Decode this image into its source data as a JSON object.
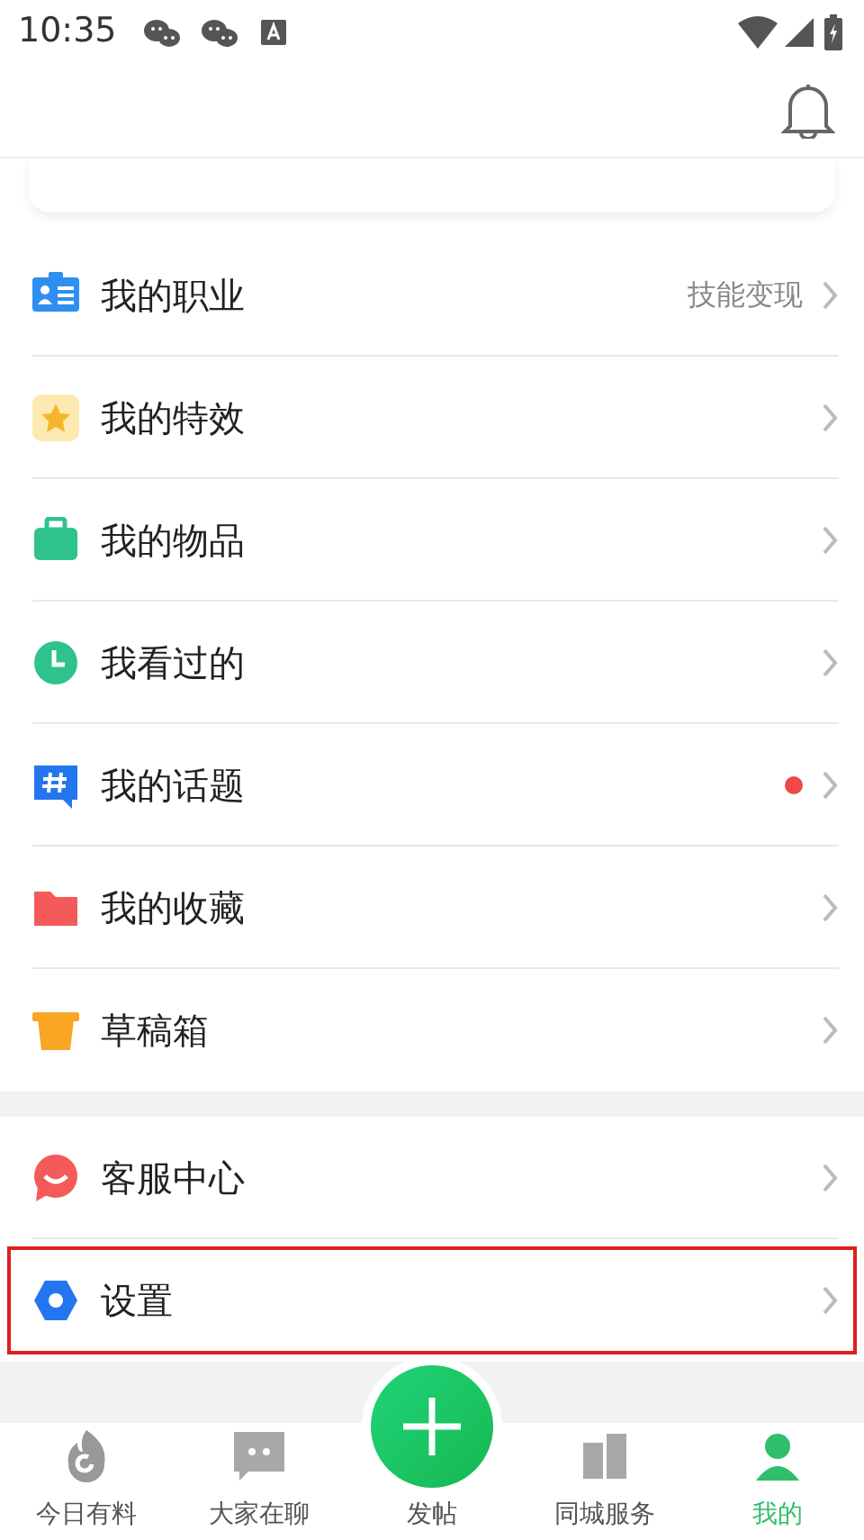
{
  "status_bar": {
    "time": "10:35"
  },
  "sections": [
    {
      "items": [
        {
          "label": "我的职业",
          "value": "技能变现",
          "dot": false,
          "highlighted": false
        },
        {
          "label": "我的特效",
          "dot": false,
          "highlighted": false
        },
        {
          "label": "我的物品",
          "dot": false,
          "highlighted": false
        },
        {
          "label": "我看过的",
          "dot": false,
          "highlighted": false
        },
        {
          "label": "我的话题",
          "dot": true,
          "highlighted": false
        },
        {
          "label": "我的收藏",
          "dot": false,
          "highlighted": false
        },
        {
          "label": "草稿箱",
          "dot": false,
          "highlighted": false
        }
      ]
    },
    {
      "items": [
        {
          "label": "客服中心",
          "dot": false,
          "highlighted": false
        },
        {
          "label": "设置",
          "dot": false,
          "highlighted": true
        }
      ]
    }
  ],
  "tab_bar": [
    {
      "label": "今日有料",
      "selected": false
    },
    {
      "label": "大家在聊",
      "selected": false
    },
    {
      "label": "发帖",
      "kind": "post",
      "selected": false
    },
    {
      "label": "同城服务",
      "selected": false
    },
    {
      "label": "我的",
      "selected": true
    }
  ]
}
